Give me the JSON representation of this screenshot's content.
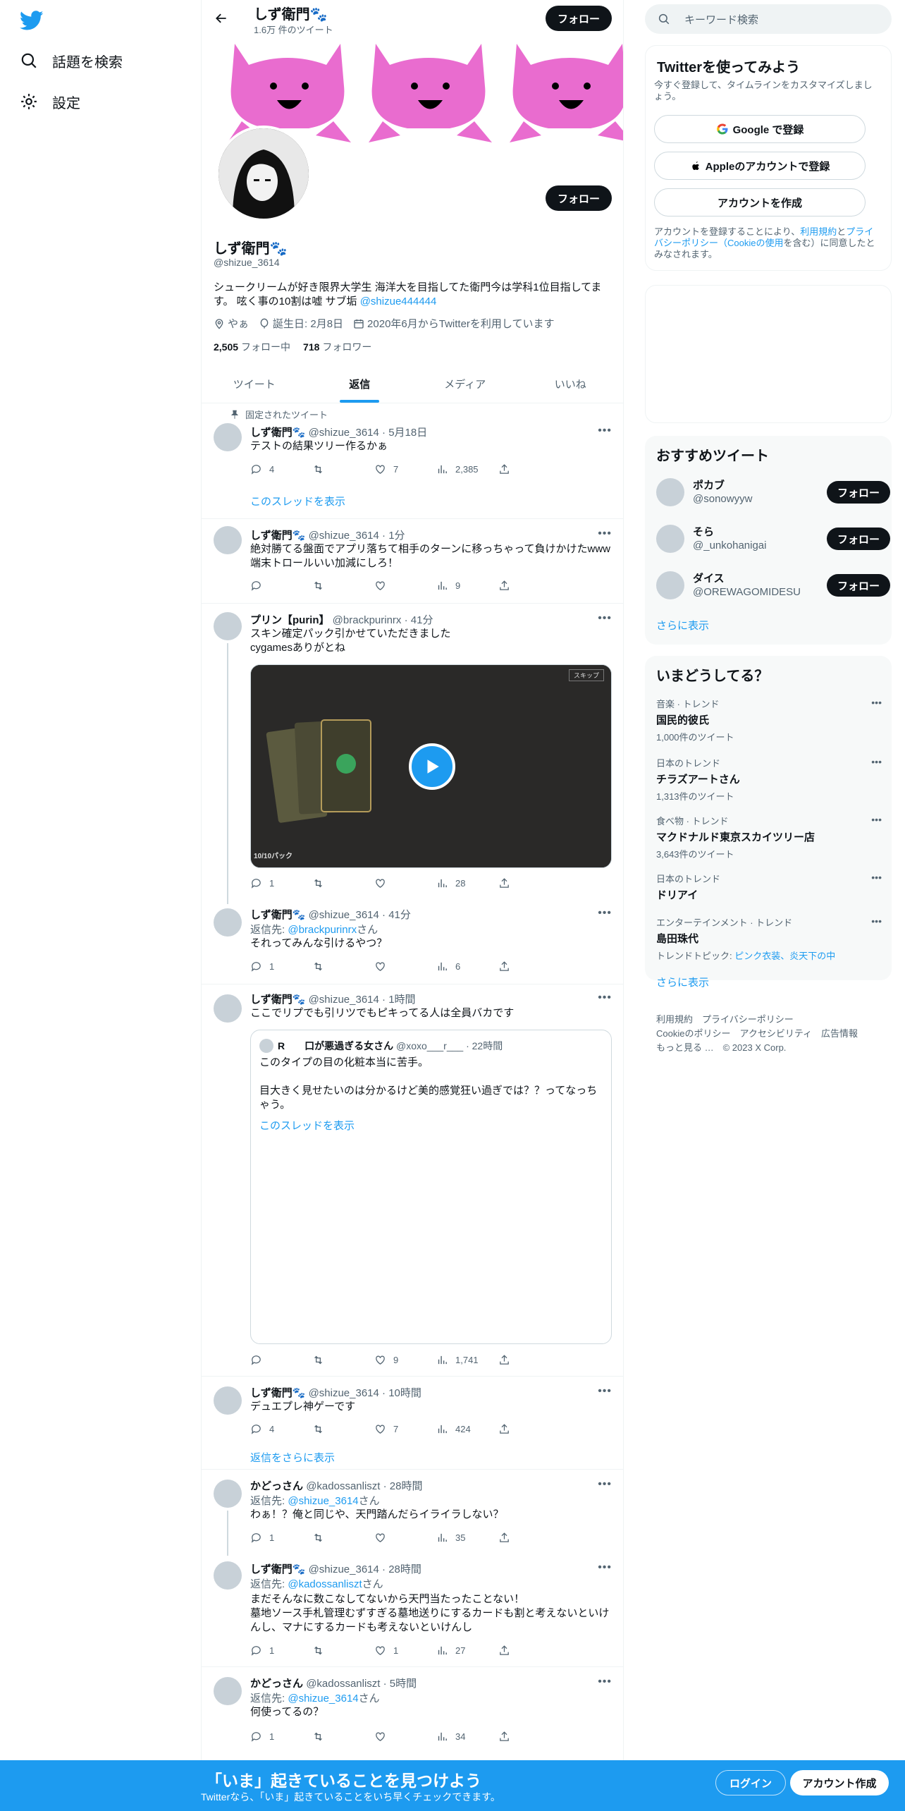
{
  "nav": {
    "explore_label": "話題を検索",
    "settings_label": "設定"
  },
  "profile": {
    "name": "しず衛門🐾",
    "tweet_count": "1.6万 件のツイート",
    "follow_label": "フォロー",
    "handle": "@shizue_3614",
    "bio_text": "シュークリームが好き限界大学生 海洋大を目指してた衛門今は学科1位目指してます。 呟く事の10割は嘘 サブ垢 ",
    "bio_link": "@shizue444444",
    "location": "やぁ",
    "birthday": "誕生日: 2月8日",
    "joined": "2020年6月からTwitterを利用しています",
    "following_count": "2,505",
    "following_label": "フォロー中",
    "followers_count": "718",
    "followers_label": "フォロワー"
  },
  "tabs": [
    "ツイート",
    "返信",
    "メディア",
    "いいね"
  ],
  "tweets": [
    {
      "pinned_label": "固定されたツイート",
      "name": "しず衛門🐾",
      "handle": "@shizue_3614 · 5月18日",
      "text": "テストの結果ツリー作るかぁ",
      "replies": "4",
      "retweets": "",
      "likes": "7",
      "views": "2,385",
      "thread_link": "このスレッドを表示"
    },
    {
      "name": "しず衛門🐾",
      "handle": "@shizue_3614 · 1分",
      "text": "絶対勝てる盤面でアプリ落ちて相手のターンに移っちゃって負けかけたwww端末トロールいい加減にしろ！",
      "replies": "",
      "retweets": "",
      "likes": "",
      "views": "9"
    },
    {
      "name": "プリン【purin】",
      "handle": "@brackpurinrx · 41分",
      "text": "スキン確定パック引かせていただきました\ncygamesありがとね",
      "video_skip": "スキップ",
      "video_counter": "10/10パック",
      "replies": "1",
      "retweets": "",
      "likes": "",
      "views": "28"
    },
    {
      "name": "しず衛門🐾",
      "handle": "@shizue_3614 · 41分",
      "reply_to_prefix": "返信先: ",
      "reply_to_handle": "@brackpurinrx",
      "reply_to_suffix": "さん",
      "text": "それってみんな引けるやつ？",
      "replies": "1",
      "retweets": "",
      "likes": "",
      "views": "6"
    },
    {
      "name": "しず衛門🐾",
      "handle": "@shizue_3614 · 1時間",
      "text": "ここでリプでも引リツでもピキってる人は全員バカです",
      "quote_name": "R　　口が悪過ぎる女さん",
      "quote_handle": "@xoxo___r___ · 22時間",
      "quote_text": "このタイプの目の化粧本当に苦手。\n\n目大きく見せたいのは分かるけど美的感覚狂い過ぎでは？？ってなっちゃう。",
      "quote_thread": "このスレッドを表示",
      "replies": "",
      "retweets": "",
      "likes": "9",
      "views": "1,741"
    },
    {
      "name": "しず衛門🐾",
      "handle": "@shizue_3614 · 10時間",
      "text": "デュエプレ神ゲーです",
      "replies": "4",
      "retweets": "",
      "likes": "7",
      "views": "424",
      "more_replies": "返信をさらに表示"
    },
    {
      "name": "かどっさん",
      "handle": "@kadossanliszt · 28時間",
      "reply_to_prefix": "返信先: ",
      "reply_to_handle": "@shizue_3614",
      "reply_to_suffix": "さん",
      "text": "わぁ！？俺と同じや、天門踏んだらイライラしない？",
      "replies": "1",
      "retweets": "",
      "likes": "",
      "views": "35"
    },
    {
      "name": "しず衛門🐾",
      "handle": "@shizue_3614 · 28時間",
      "reply_to_prefix": "返信先: ",
      "reply_to_handle": "@kadossanliszt",
      "reply_to_suffix": "さん",
      "text": "まだそんなに数こなしてないから天門当たったことない！\n墓地ソース手札管理むずすぎる墓地送りにするカードも割と考えないといけんし、マナにするカードも考えないといけんし",
      "replies": "1",
      "retweets": "",
      "likes": "1",
      "views": "27"
    },
    {
      "name": "かどっさん",
      "handle": "@kadossanliszt · 5時間",
      "reply_to_prefix": "返信先: ",
      "reply_to_handle": "@shizue_3614",
      "reply_to_suffix": "さん",
      "text": "何使ってるの？",
      "replies": "1",
      "retweets": "",
      "likes": "",
      "views": "34"
    }
  ],
  "right": {
    "search_placeholder": "キーワード検索",
    "signup_title": "Twitterを使ってみよう",
    "signup_sub": "今すぐ登録して、タイムラインをカスタマイズしましょう。",
    "google_btn": "Google で登録",
    "apple_btn": "Appleのアカウントで登録",
    "create_btn": "アカウントを作成",
    "terms_1": "アカウントを登録することにより、",
    "terms_link1": "利用規約",
    "terms_2": "と",
    "terms_link2": "プライバシーポリシー（Cookieの使用",
    "terms_3": "を含む）に同意したとみなされます。",
    "rec_title": "おすすめツイート",
    "rec": [
      {
        "name": "ポカブ",
        "handle": "@sonowyyw"
      },
      {
        "name": "そら",
        "handle": "@_unkohanigai"
      },
      {
        "name": "ダイス",
        "handle": "@OREWAGOMIDESU"
      }
    ],
    "rec_follow": "フォロー",
    "show_more": "さらに表示",
    "trends_title": "いまどうしてる？",
    "trends": [
      {
        "cat": "音楽 · トレンド",
        "name": "国民的彼氏",
        "count": "1,000件のツイート"
      },
      {
        "cat": "日本のトレンド",
        "name": "チラズアートさん",
        "count": "1,313件のツイート"
      },
      {
        "cat": "食べ物 · トレンド",
        "name": "マクドナルド東京スカイツリー店",
        "count": "3,643件のツイート"
      },
      {
        "cat": "日本のトレンド",
        "name": "ドリアイ",
        "count": ""
      },
      {
        "cat": "エンターテインメント · トレンド",
        "name": "島田珠代",
        "count_prefix": "トレンドトピック: ",
        "count_link": "ピンク衣装、炎天下の中"
      }
    ],
    "footer_line1": "利用規約　プライバシーポリシー",
    "footer_line2": "Cookieのポリシー　アクセシビリティ　広告情報",
    "footer_line3": "もっと見る …　© 2023 X Corp."
  },
  "bottom": {
    "title": "「いま」起きていることを見つけよう",
    "sub": "Twitterなら、「いま」起きていることをいち早くチェックできます。",
    "login": "ログイン",
    "signup": "アカウント作成"
  },
  "colors": {
    "accent": "#1d9bf0",
    "text": "#0f1419",
    "muted": "#536471",
    "banner_cat": "#e96ccf"
  }
}
